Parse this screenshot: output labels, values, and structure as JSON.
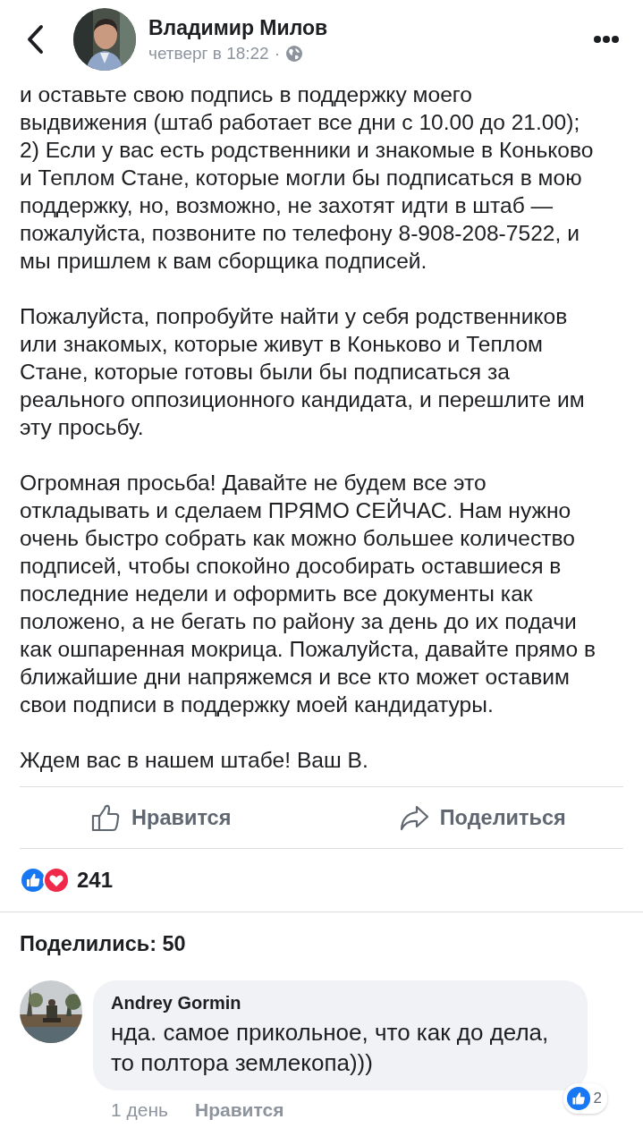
{
  "header": {
    "author": "Владимир Милов",
    "time": "четверг в 18:22",
    "separator": "·"
  },
  "post": {
    "paragraphs": [
      "и оставьте свою подпись в поддержку моего\nвыдвижения (штаб работает все дни с 10.00 до 21.00);\n2) Если у вас есть родственники и знакомые в Коньково\nи Теплом Стане, которые могли бы подписаться в мою\nподдержку, но, возможно, не захотят идти в штаб —\nпожалуйста, позвоните по телефону 8-908-208-7522, и\nмы пришлем к вам сборщика подписей.",
      "Пожалуйста, попробуйте найти у себя родственников\nили знакомых, которые живут в Коньково и Теплом\nСтане, которые готовы были бы подписаться за\nреального оппозиционного кандидата, и перешлите им\nэту просьбу.",
      "Огромная просьба! Давайте не будем все это\nоткладывать и сделаем ПРЯМО СЕЙЧАС. Нам нужно\nочень быстро собрать как можно большее количество\nподписей, чтобы спокойно дособирать оставшиеся в\nпоследние недели и оформить все документы как\nположено, а не бегать по району за день до их подачи\nкак ошпаренная мокрица. Пожалуйста, давайте прямо в\nближайшие дни напряжемся и все кто может оставим\nсвои подписи в поддержку моей кандидатуры.",
      "Ждем вас в нашем штабе! Ваш В."
    ]
  },
  "actions": [
    {
      "kind": "like",
      "label": "Нравится"
    },
    {
      "kind": "share",
      "label": "Поделиться"
    }
  ],
  "reactions": {
    "count": "241"
  },
  "shares": "Поделились: 50",
  "comments": [
    {
      "author": "Andrey Gormin",
      "text": "нда. самое прикольное, что как до дела,\nто полтора землекопа)))",
      "time": "1 день",
      "like_label": "Нравится",
      "like_count": "2"
    }
  ]
}
